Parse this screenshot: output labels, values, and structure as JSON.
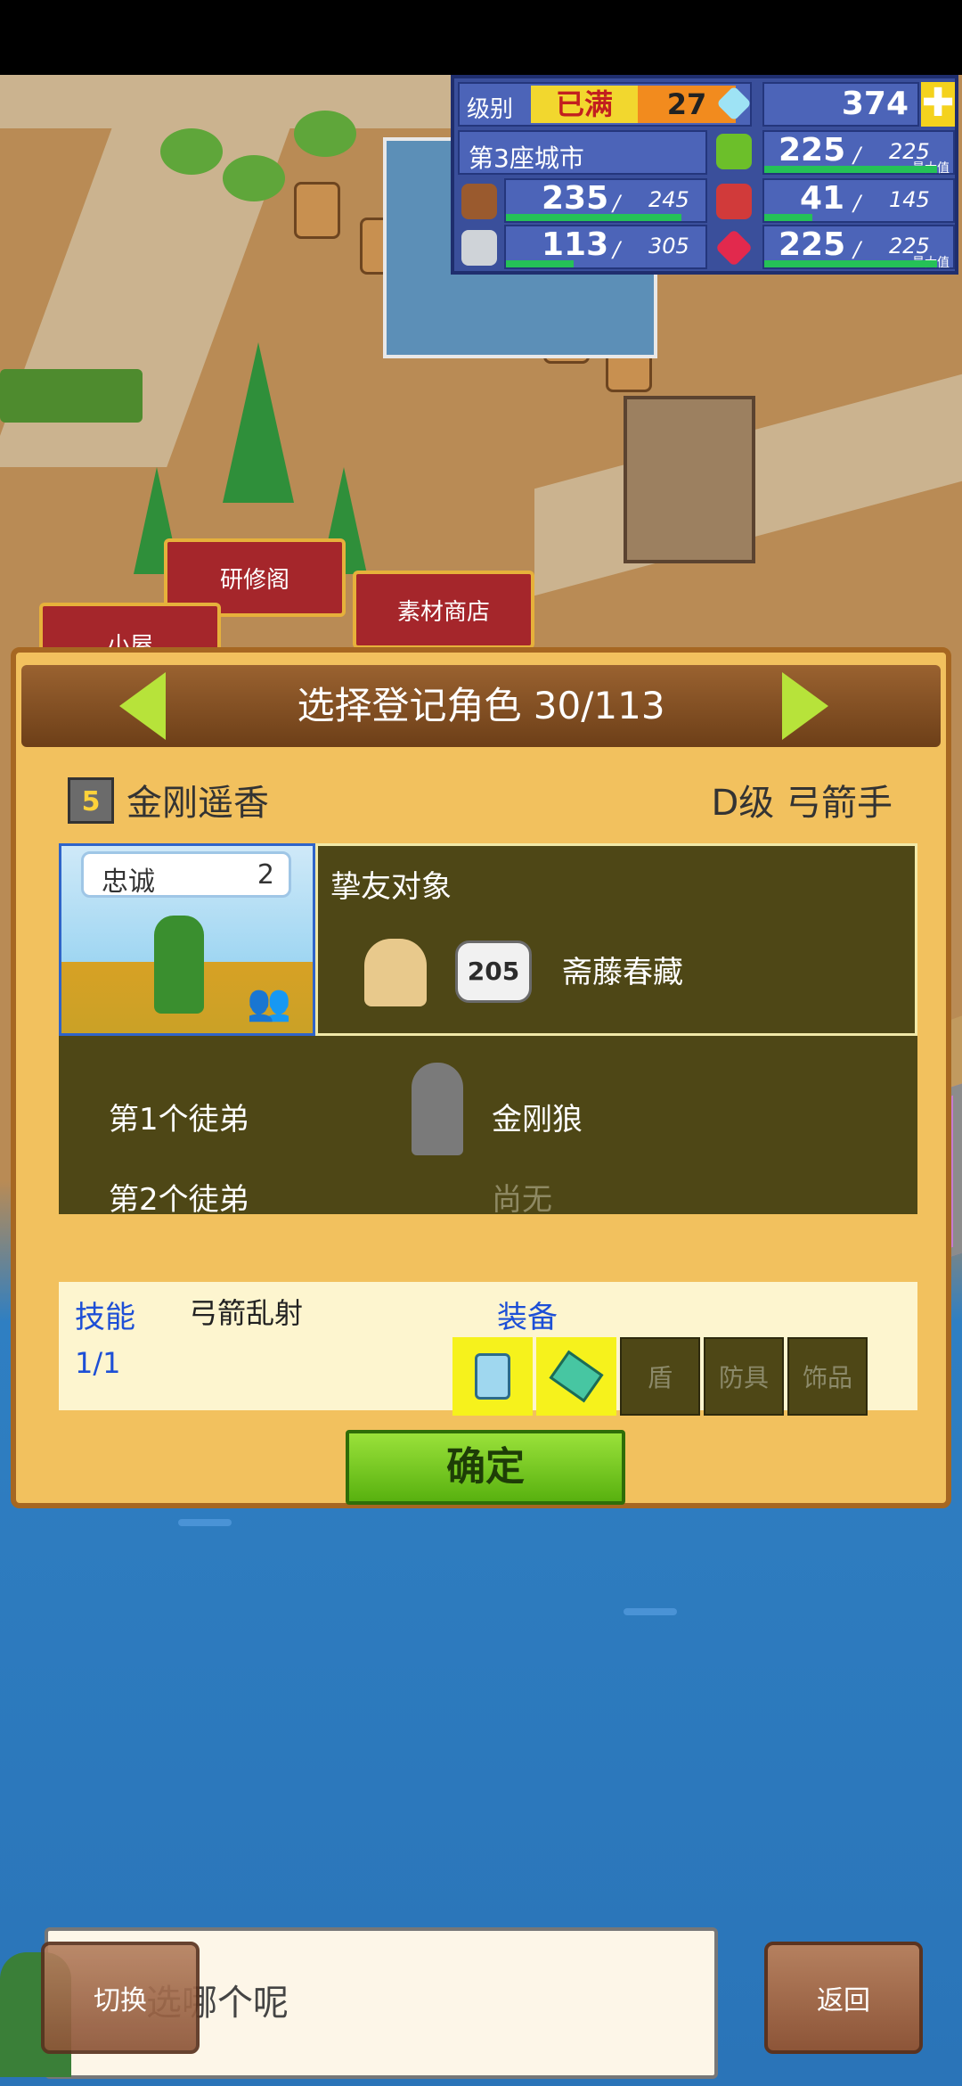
{
  "resources": {
    "level_label": "级别",
    "level_badge": "已满",
    "level_value": "27",
    "diamonds": "374",
    "city_name": "第3座城市",
    "food_current": "225",
    "food_max": "225",
    "food_note": "最大值",
    "wood_current": "235",
    "wood_max": "245",
    "fruit_current": "41",
    "fruit_max": "145",
    "stone_current": "113",
    "stone_max": "305",
    "gem_current": "225",
    "gem_max": "225",
    "gem_note": "最大值",
    "separator": "/",
    "progress": {
      "food": 1.0,
      "wood": 0.96,
      "fruit": 0.28,
      "stone": 0.37,
      "gem": 1.0
    }
  },
  "buildings": {
    "research": "研修阁",
    "materials_shop": "素材商店",
    "hut": "小屋"
  },
  "dialog": {
    "title": "选择登记角色 30/113",
    "character_name": "金刚遥香",
    "character_class": "D级 弓箭手",
    "loyalty_label": "忠诚",
    "loyalty_value": "2",
    "friend_label": "挚友对象",
    "friend_badge": "205",
    "friend_name": "斋藤春藏",
    "apprentice1_label": "第1个徒弟",
    "apprentice1_name": "金刚狼",
    "apprentice2_label": "第2个徒弟",
    "apprentice2_name": "尚无",
    "skill_label": "技能",
    "skill_count": "1/1",
    "skill_name": "弓箭乱射",
    "equip_label": "装备",
    "equip_slots": [
      "",
      "",
      "盾",
      "防具",
      "饰品"
    ],
    "confirm": "确定"
  },
  "bottom": {
    "message": "选哪个呢",
    "switch": "切换",
    "back": "返回"
  },
  "colors": {
    "accent_green": "#7bd21d",
    "arrow": "#b7e33a",
    "skill_blue": "#1d4fd6",
    "panel_olive": "#4e4716"
  }
}
